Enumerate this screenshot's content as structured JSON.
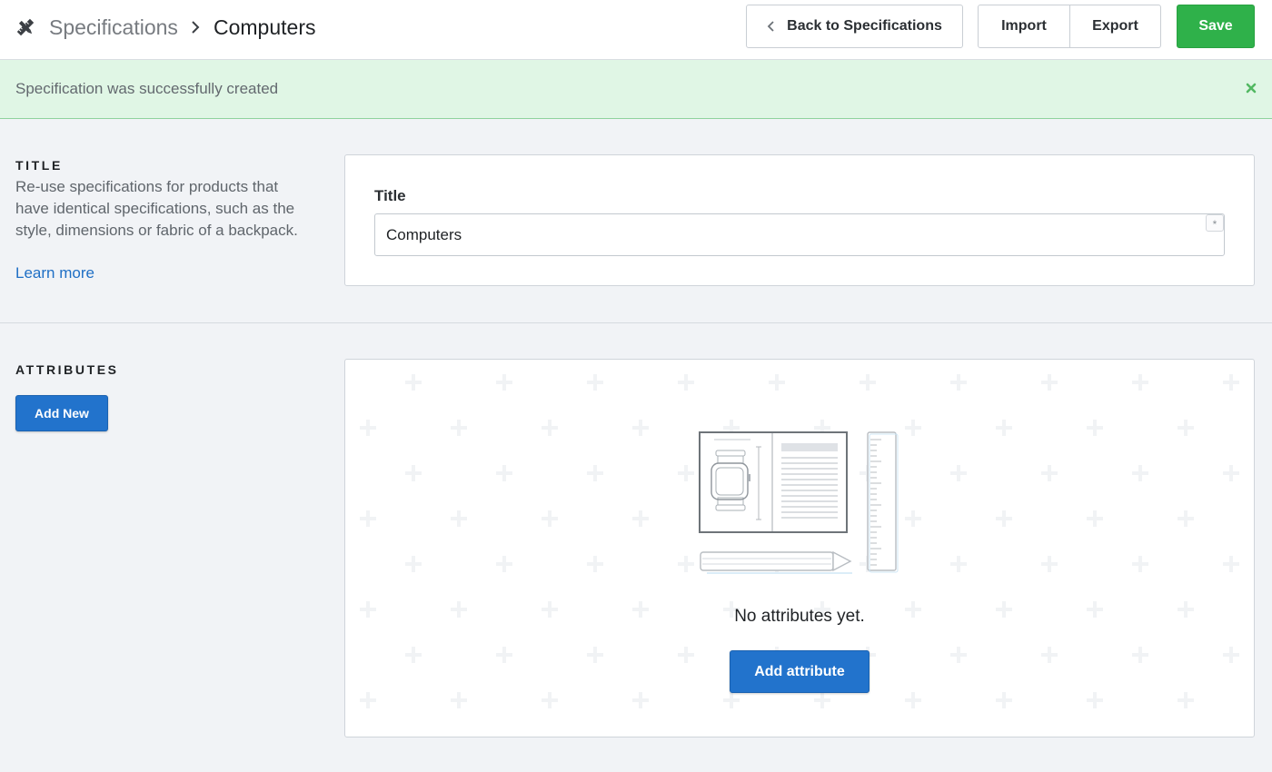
{
  "header": {
    "app_icon": "pencil-ruler-icon",
    "breadcrumb_parent": "Specifications",
    "breadcrumb_current": "Computers",
    "back_label": "Back to Specifications",
    "import_label": "Import",
    "export_label": "Export",
    "save_label": "Save"
  },
  "alert": {
    "message": "Specification was successfully created",
    "close_icon": "close-icon"
  },
  "title_section": {
    "heading": "TITLE",
    "description": "Re-use specifications for products that have identical specifications, such as the style, dimensions or fabric of a backpack.",
    "learn_more": "Learn more",
    "field_label": "Title",
    "field_value": "Computers",
    "required_marker": "*"
  },
  "attributes_section": {
    "heading": "ATTRIBUTES",
    "add_new_label": "Add New",
    "empty_illustration": "spec-sheet-illustration",
    "empty_message": "No attributes yet.",
    "add_attribute_label": "Add attribute"
  },
  "colors": {
    "save_green": "#2fb14a",
    "primary_blue": "#2273cc",
    "alert_background": "#e0f6e5",
    "link_blue": "#1f6fc5"
  }
}
